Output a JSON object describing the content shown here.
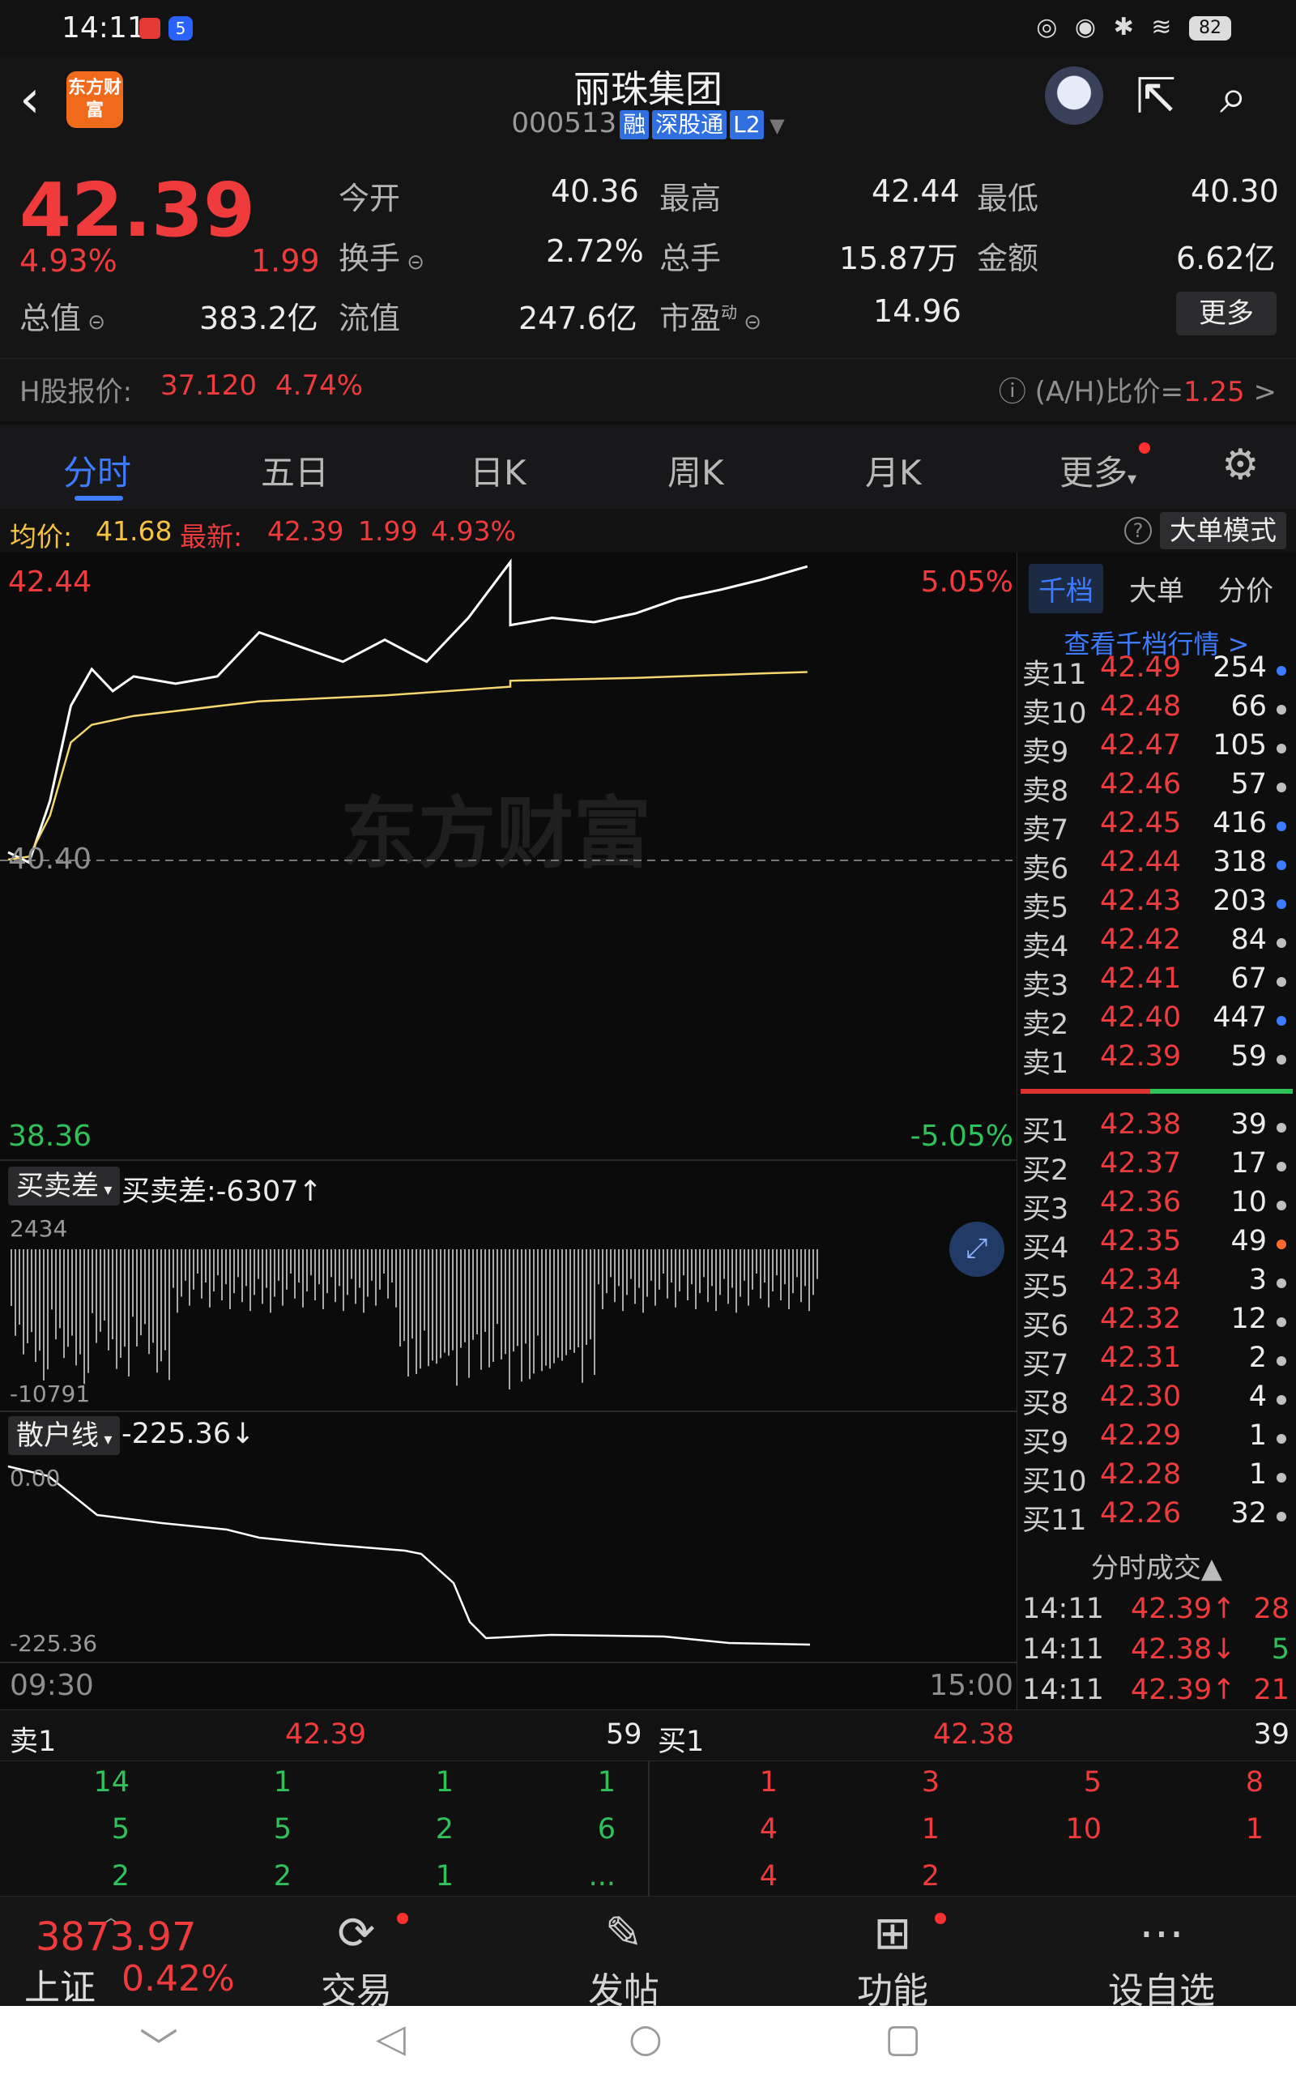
{
  "statusbar": {
    "time": "14:11",
    "app_badge": "5",
    "icons": "◎ ◉ ✱ ≋",
    "battery": "82"
  },
  "header": {
    "logo": "东方财富",
    "title": "丽珠集团",
    "code": "000513",
    "tags": [
      "融",
      "深股通",
      "L2"
    ]
  },
  "quote": {
    "price": "42.39",
    "pct": "4.93%",
    "change": "1.99",
    "open_label": "今开",
    "open": "40.36",
    "high_label": "最高",
    "high": "42.44",
    "low_label": "最低",
    "low": "40.30",
    "turnover_label": "换手",
    "turnover": "2.72%",
    "volume_label": "总手",
    "volume": "15.87万",
    "amount_label": "金额",
    "amount": "6.62亿",
    "mktcap_label": "总值",
    "mktcap": "383.2亿",
    "float_label": "流值",
    "float": "247.6亿",
    "pe_label": "市盈",
    "pe_sup": "动",
    "pe": "14.96",
    "more": "更多",
    "h_label": "H股报价:",
    "h_price": "37.120",
    "h_pct": "4.74%",
    "ah_label": "(A/H)比价=",
    "ah_value": "1.25",
    "ah_arrow": ">"
  },
  "tabs": [
    "分时",
    "五日",
    "日K",
    "周K",
    "月K",
    "更多"
  ],
  "avgbar": {
    "avg_label": "均价:",
    "avg": "41.68",
    "latest_label": "最新:",
    "latest": "42.39",
    "change": "1.99",
    "pct": "4.93%",
    "mode_button": "大单模式"
  },
  "chart": {
    "top_price": "42.44",
    "top_pct": "5.05%",
    "bottom_price": "38.36",
    "bottom_pct": "-5.05%",
    "preclose": "40.40",
    "watermark": "东方财富",
    "diff_label": "买卖差",
    "diff_value": "买卖差:-6307↑",
    "diff_max": "2434",
    "diff_min": "-10791",
    "retail_label": "散户线",
    "retail_value": "-225.36↓",
    "retail_max": "0.00",
    "retail_min": "-225.36",
    "start_time": "09:30",
    "end_time": "15:00"
  },
  "chart_data": {
    "type": "line",
    "title": "",
    "xlabel": "",
    "ylabel": "",
    "x_range": [
      "09:30",
      "15:00"
    ],
    "ylim": [
      38.36,
      42.44
    ],
    "preclose": 40.4,
    "series": [
      {
        "name": "",
        "x": [
          "09:30",
          "09:35",
          "09:40",
          "09:45",
          "09:50",
          "09:55",
          "10:00",
          "10:10",
          "10:20",
          "10:30",
          "10:40",
          "10:50",
          "11:00",
          "11:10",
          "11:20",
          "11:30",
          "13:00",
          "13:10",
          "13:20",
          "13:30",
          "13:40",
          "13:50",
          "14:00",
          "14:11"
        ],
        "values": [
          40.45,
          40.38,
          40.8,
          41.45,
          41.7,
          41.55,
          41.65,
          41.6,
          41.65,
          41.95,
          41.85,
          41.75,
          41.9,
          41.75,
          42.05,
          42.43,
          42.0,
          42.05,
          42.02,
          42.08,
          42.18,
          42.24,
          42.31,
          42.4
        ]
      },
      {
        "name": "均价",
        "x": [
          "09:30",
          "09:35",
          "09:40",
          "09:45",
          "09:50",
          "10:00",
          "10:30",
          "11:00",
          "11:30",
          "13:00",
          "13:30",
          "14:00",
          "14:11"
        ],
        "values": [
          40.4,
          40.42,
          40.7,
          41.2,
          41.32,
          41.38,
          41.48,
          41.52,
          41.58,
          41.62,
          41.64,
          41.67,
          41.68
        ]
      }
    ]
  },
  "orderbook": {
    "subtabs": [
      "千档",
      "大单",
      "分价"
    ],
    "view_link": "查看千档行情 >",
    "asks": [
      {
        "k": "卖11",
        "p": "42.49",
        "v": "254",
        "dot": "blue"
      },
      {
        "k": "卖10",
        "p": "42.48",
        "v": "66",
        "dot": "gray"
      },
      {
        "k": "卖9",
        "p": "42.47",
        "v": "105",
        "dot": "gray"
      },
      {
        "k": "卖8",
        "p": "42.46",
        "v": "57",
        "dot": "gray"
      },
      {
        "k": "卖7",
        "p": "42.45",
        "v": "416",
        "dot": "blue"
      },
      {
        "k": "卖6",
        "p": "42.44",
        "v": "318",
        "dot": "blue"
      },
      {
        "k": "卖5",
        "p": "42.43",
        "v": "203",
        "dot": "blue"
      },
      {
        "k": "卖4",
        "p": "42.42",
        "v": "84",
        "dot": "gray"
      },
      {
        "k": "卖3",
        "p": "42.41",
        "v": "67",
        "dot": "gray"
      },
      {
        "k": "卖2",
        "p": "42.40",
        "v": "447",
        "dot": "blue"
      },
      {
        "k": "卖1",
        "p": "42.39",
        "v": "59",
        "dot": "gray"
      }
    ],
    "bids": [
      {
        "k": "买1",
        "p": "42.38",
        "v": "39",
        "dot": "gray"
      },
      {
        "k": "买2",
        "p": "42.37",
        "v": "17",
        "dot": "gray"
      },
      {
        "k": "买3",
        "p": "42.36",
        "v": "10",
        "dot": "gray"
      },
      {
        "k": "买4",
        "p": "42.35",
        "v": "49",
        "dot": "orange"
      },
      {
        "k": "买5",
        "p": "42.34",
        "v": "3",
        "dot": "gray"
      },
      {
        "k": "买6",
        "p": "42.32",
        "v": "12",
        "dot": "gray"
      },
      {
        "k": "买7",
        "p": "42.31",
        "v": "2",
        "dot": "gray"
      },
      {
        "k": "买8",
        "p": "42.30",
        "v": "4",
        "dot": "gray"
      },
      {
        "k": "买9",
        "p": "42.29",
        "v": "1",
        "dot": "gray"
      },
      {
        "k": "买10",
        "p": "42.28",
        "v": "1",
        "dot": "gray"
      },
      {
        "k": "买11",
        "p": "42.26",
        "v": "32",
        "dot": "gray"
      }
    ],
    "trades_title": "分时成交▲",
    "trades": [
      {
        "t": "14:11",
        "p": "42.39↑",
        "v": "28",
        "dir": "up"
      },
      {
        "t": "14:11",
        "p": "42.38↓",
        "v": "5",
        "dir": "down"
      },
      {
        "t": "14:11",
        "p": "42.39↑",
        "v": "21",
        "dir": "up"
      }
    ]
  },
  "tickbar": {
    "sell_label": "卖1",
    "sell_price": "42.39",
    "sell_vol": "59",
    "buy_label": "买1",
    "buy_price": "42.38",
    "buy_vol": "39"
  },
  "tickgrid": {
    "left": [
      [
        "14",
        "1",
        "1",
        "1"
      ],
      [
        "5",
        "5",
        "2",
        "6"
      ],
      [
        "2",
        "2",
        "1",
        "..."
      ]
    ],
    "right": [
      [
        "1",
        "3",
        "5",
        "8"
      ],
      [
        "4",
        "1",
        "10",
        "1"
      ],
      [
        "4",
        "2",
        "",
        ""
      ]
    ]
  },
  "bottomnav": {
    "index_value": "3873.97",
    "index_name": "上证",
    "index_pct": "0.42%",
    "items": [
      "交易",
      "发帖",
      "功能",
      "设自选"
    ]
  },
  "sysnav": {
    "down": "﹀",
    "back": "◁",
    "home": "○",
    "recent": "▢"
  },
  "colors": {
    "up": "#ef3b3b",
    "down": "#2fc25b",
    "accent": "#3d7bff",
    "avg_line": "#f5d76e"
  }
}
